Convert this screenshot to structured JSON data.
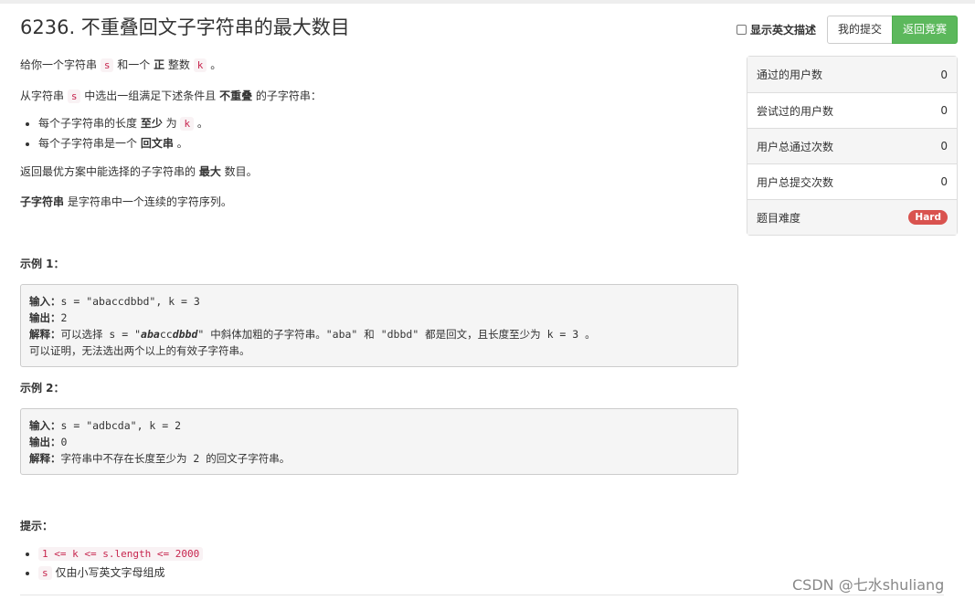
{
  "problem": {
    "title": "6236. 不重叠回文子字符串的最大数目"
  },
  "toolbar": {
    "english_toggle_label": "显示英文描述",
    "my_submissions_label": "我的提交",
    "back_to_contest_label": "返回竞赛"
  },
  "description": {
    "p1": {
      "a": "给你一个字符串 ",
      "s": "s",
      "b": " 和一个 ",
      "bold": "正",
      "c": " 整数 ",
      "k": "k",
      "d": " 。"
    },
    "p2": {
      "a": "从字符串 ",
      "s": "s",
      "b": " 中选出一组满足下述条件且 ",
      "bold": "不重叠",
      "c": " 的子字符串："
    },
    "bullets": [
      {
        "a": "每个子字符串的长度 ",
        "bold": "至少",
        "b": " 为 ",
        "k": "k",
        "c": " 。"
      },
      {
        "a": "每个子字符串是一个 ",
        "bold": "回文串",
        "b": " 。"
      }
    ],
    "p3": {
      "a": "返回最优方案中能选择的子字符串的 ",
      "bold": "最大",
      "b": " 数目。"
    },
    "p4": {
      "bold": "子字符串",
      "a": " 是字符串中一个连续的字符序列。"
    }
  },
  "examples": [
    {
      "title": "示例 1：",
      "input_label": "输入：",
      "input": "s = \"abaccdbbd\", k = 3",
      "output_label": "输出：",
      "output": "2",
      "explain_label": "解释：",
      "explain_a": "可以选择 s = \"",
      "explain_em": "aba",
      "explain_mid": "cc",
      "explain_em2": "dbbd",
      "explain_b": "\" 中斜体加粗的子字符串。\"aba\" 和 \"dbbd\" 都是回文，且长度至少为 k = 3 。",
      "explain_line2": "可以证明，无法选出两个以上的有效子字符串。"
    },
    {
      "title": "示例 2：",
      "input_label": "输入：",
      "input": "s = \"adbcda\", k = 2",
      "output_label": "输出：",
      "output": "0",
      "explain_label": "解释：",
      "explain": "字符串中不存在长度至少为 2 的回文子字符串。"
    }
  ],
  "tips": {
    "title": "提示：",
    "items": [
      {
        "code": "1 <= k <= s.length <= 2000",
        "text": ""
      },
      {
        "code": "s",
        "text": " 仅由小写英文字母组成"
      }
    ]
  },
  "stats": [
    {
      "label": "通过的用户数",
      "value": "0"
    },
    {
      "label": "尝试过的用户数",
      "value": "0"
    },
    {
      "label": "用户总通过次数",
      "value": "0"
    },
    {
      "label": "用户总提交次数",
      "value": "0"
    },
    {
      "label": "题目难度",
      "badge": "Hard"
    }
  ],
  "colors": {
    "success_button": "#5cb85c",
    "hard_badge": "#d9534f",
    "inline_code": "#c7254e"
  },
  "watermark": "CSDN @七水shuliang"
}
